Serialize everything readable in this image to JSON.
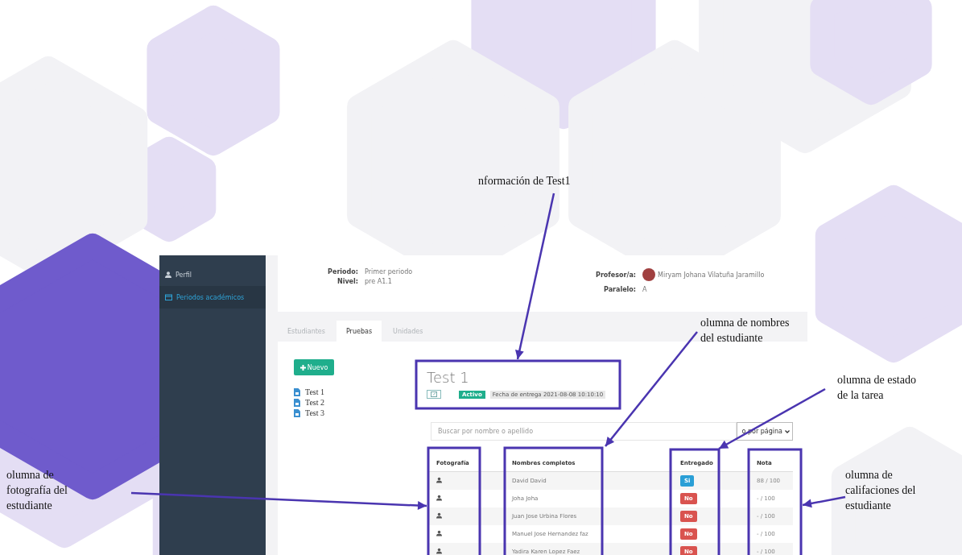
{
  "annotations": [
    {
      "lines": [
        "nformación de Test1"
      ]
    },
    {
      "lines": [
        "olumna de nombres",
        "del estudiante"
      ]
    },
    {
      "lines": [
        "olumna de estado",
        "de la tarea"
      ]
    },
    {
      "lines": [
        "olumna de",
        "fotografía del",
        "estudiante"
      ]
    },
    {
      "lines": [
        "olumna de",
        "califaciones del",
        "estudiante"
      ]
    }
  ],
  "sidebar": {
    "items": [
      {
        "label": "Perfil",
        "selected": false
      },
      {
        "label": "Periodos académicos",
        "selected": true
      }
    ]
  },
  "info": {
    "left": [
      {
        "label": "Periodo:",
        "value": "Primer periodo"
      },
      {
        "label": "Nivel:",
        "value": "pre A1.1"
      }
    ],
    "right": [
      {
        "label": "Profesor/a:",
        "value": "Miryam Johana Vilatuña Jaramillo",
        "avatar": true
      },
      {
        "label": "Paralelo:",
        "value": "A",
        "avatar": false
      }
    ]
  },
  "tabs": [
    {
      "label": "Estudiantes",
      "selected": false
    },
    {
      "label": "Pruebas",
      "selected": true
    },
    {
      "label": "Unidades",
      "selected": false
    }
  ],
  "new_button": "Nuevo",
  "tests": [
    "Test 1",
    "Test 2",
    "Test 3"
  ],
  "test": {
    "title": "Test 1",
    "status": "Activo",
    "due": "Fecha de entrega 2021-08-08 10:10:10"
  },
  "search": {
    "placeholder": "Buscar por nombre o apellido"
  },
  "page_size": "o por página",
  "table": {
    "columns": [
      "Fotografía",
      "Nombres completos",
      "Entregado",
      "Nota"
    ],
    "rows": [
      {
        "name": "David David",
        "delivered": true,
        "delivered_label": "Si",
        "grade": "88 / 100"
      },
      {
        "name": "Joha Joha",
        "delivered": false,
        "delivered_label": "No",
        "grade": "- / 100"
      },
      {
        "name": "Juan Jose Urbina Flores",
        "delivered": false,
        "delivered_label": "No",
        "grade": "- / 100"
      },
      {
        "name": "Manuel Jose Hernandez faz",
        "delivered": false,
        "delivered_label": "No",
        "grade": "- / 100"
      },
      {
        "name": "Yadira Karen Lopez Faez",
        "delivered": false,
        "delivered_label": "No",
        "grade": "- / 100"
      }
    ]
  }
}
